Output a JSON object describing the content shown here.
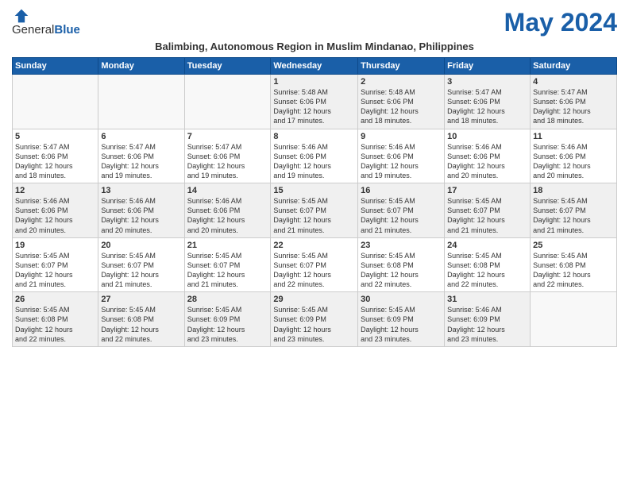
{
  "logo": {
    "general": "General",
    "blue": "Blue"
  },
  "title": "May 2024",
  "subtitle": "Balimbing, Autonomous Region in Muslim Mindanao, Philippines",
  "days_of_week": [
    "Sunday",
    "Monday",
    "Tuesday",
    "Wednesday",
    "Thursday",
    "Friday",
    "Saturday"
  ],
  "weeks": [
    [
      {
        "day": "",
        "info": ""
      },
      {
        "day": "",
        "info": ""
      },
      {
        "day": "",
        "info": ""
      },
      {
        "day": "1",
        "info": "Sunrise: 5:48 AM\nSunset: 6:06 PM\nDaylight: 12 hours\nand 17 minutes."
      },
      {
        "day": "2",
        "info": "Sunrise: 5:48 AM\nSunset: 6:06 PM\nDaylight: 12 hours\nand 18 minutes."
      },
      {
        "day": "3",
        "info": "Sunrise: 5:47 AM\nSunset: 6:06 PM\nDaylight: 12 hours\nand 18 minutes."
      },
      {
        "day": "4",
        "info": "Sunrise: 5:47 AM\nSunset: 6:06 PM\nDaylight: 12 hours\nand 18 minutes."
      }
    ],
    [
      {
        "day": "5",
        "info": "Sunrise: 5:47 AM\nSunset: 6:06 PM\nDaylight: 12 hours\nand 18 minutes."
      },
      {
        "day": "6",
        "info": "Sunrise: 5:47 AM\nSunset: 6:06 PM\nDaylight: 12 hours\nand 19 minutes."
      },
      {
        "day": "7",
        "info": "Sunrise: 5:47 AM\nSunset: 6:06 PM\nDaylight: 12 hours\nand 19 minutes."
      },
      {
        "day": "8",
        "info": "Sunrise: 5:46 AM\nSunset: 6:06 PM\nDaylight: 12 hours\nand 19 minutes."
      },
      {
        "day": "9",
        "info": "Sunrise: 5:46 AM\nSunset: 6:06 PM\nDaylight: 12 hours\nand 19 minutes."
      },
      {
        "day": "10",
        "info": "Sunrise: 5:46 AM\nSunset: 6:06 PM\nDaylight: 12 hours\nand 20 minutes."
      },
      {
        "day": "11",
        "info": "Sunrise: 5:46 AM\nSunset: 6:06 PM\nDaylight: 12 hours\nand 20 minutes."
      }
    ],
    [
      {
        "day": "12",
        "info": "Sunrise: 5:46 AM\nSunset: 6:06 PM\nDaylight: 12 hours\nand 20 minutes."
      },
      {
        "day": "13",
        "info": "Sunrise: 5:46 AM\nSunset: 6:06 PM\nDaylight: 12 hours\nand 20 minutes."
      },
      {
        "day": "14",
        "info": "Sunrise: 5:46 AM\nSunset: 6:06 PM\nDaylight: 12 hours\nand 20 minutes."
      },
      {
        "day": "15",
        "info": "Sunrise: 5:45 AM\nSunset: 6:07 PM\nDaylight: 12 hours\nand 21 minutes."
      },
      {
        "day": "16",
        "info": "Sunrise: 5:45 AM\nSunset: 6:07 PM\nDaylight: 12 hours\nand 21 minutes."
      },
      {
        "day": "17",
        "info": "Sunrise: 5:45 AM\nSunset: 6:07 PM\nDaylight: 12 hours\nand 21 minutes."
      },
      {
        "day": "18",
        "info": "Sunrise: 5:45 AM\nSunset: 6:07 PM\nDaylight: 12 hours\nand 21 minutes."
      }
    ],
    [
      {
        "day": "19",
        "info": "Sunrise: 5:45 AM\nSunset: 6:07 PM\nDaylight: 12 hours\nand 21 minutes."
      },
      {
        "day": "20",
        "info": "Sunrise: 5:45 AM\nSunset: 6:07 PM\nDaylight: 12 hours\nand 21 minutes."
      },
      {
        "day": "21",
        "info": "Sunrise: 5:45 AM\nSunset: 6:07 PM\nDaylight: 12 hours\nand 21 minutes."
      },
      {
        "day": "22",
        "info": "Sunrise: 5:45 AM\nSunset: 6:07 PM\nDaylight: 12 hours\nand 22 minutes."
      },
      {
        "day": "23",
        "info": "Sunrise: 5:45 AM\nSunset: 6:08 PM\nDaylight: 12 hours\nand 22 minutes."
      },
      {
        "day": "24",
        "info": "Sunrise: 5:45 AM\nSunset: 6:08 PM\nDaylight: 12 hours\nand 22 minutes."
      },
      {
        "day": "25",
        "info": "Sunrise: 5:45 AM\nSunset: 6:08 PM\nDaylight: 12 hours\nand 22 minutes."
      }
    ],
    [
      {
        "day": "26",
        "info": "Sunrise: 5:45 AM\nSunset: 6:08 PM\nDaylight: 12 hours\nand 22 minutes."
      },
      {
        "day": "27",
        "info": "Sunrise: 5:45 AM\nSunset: 6:08 PM\nDaylight: 12 hours\nand 22 minutes."
      },
      {
        "day": "28",
        "info": "Sunrise: 5:45 AM\nSunset: 6:09 PM\nDaylight: 12 hours\nand 23 minutes."
      },
      {
        "day": "29",
        "info": "Sunrise: 5:45 AM\nSunset: 6:09 PM\nDaylight: 12 hours\nand 23 minutes."
      },
      {
        "day": "30",
        "info": "Sunrise: 5:45 AM\nSunset: 6:09 PM\nDaylight: 12 hours\nand 23 minutes."
      },
      {
        "day": "31",
        "info": "Sunrise: 5:46 AM\nSunset: 6:09 PM\nDaylight: 12 hours\nand 23 minutes."
      },
      {
        "day": "",
        "info": ""
      }
    ]
  ]
}
